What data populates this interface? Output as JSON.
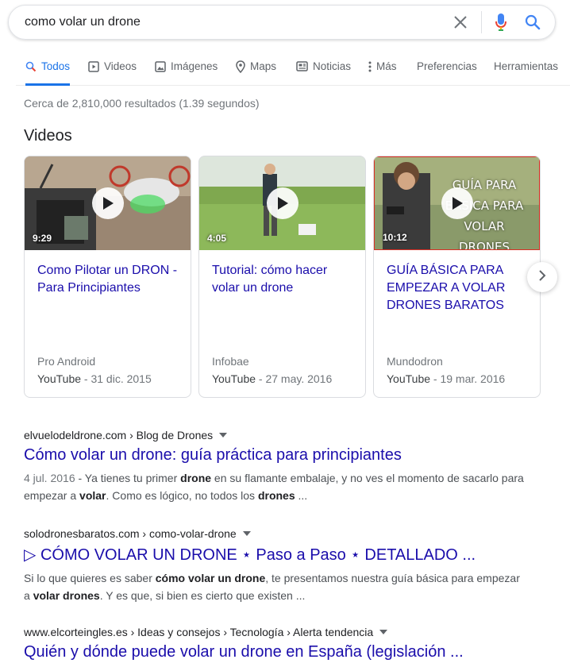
{
  "search": {
    "query": "como volar un drone"
  },
  "tabs": [
    {
      "label": "Todos"
    },
    {
      "label": "Videos"
    },
    {
      "label": "Imágenes"
    },
    {
      "label": "Maps"
    },
    {
      "label": "Noticias"
    },
    {
      "label": "Más"
    },
    {
      "label": "Preferencias"
    },
    {
      "label": "Herramientas"
    }
  ],
  "stats": "Cerca de 2,810,000 resultados (1.39 segundos)",
  "videos_heading": "Videos",
  "videos": [
    {
      "duration": "9:29",
      "title": "Como Pilotar un DRON - Para Principiantes",
      "source": "Pro Android",
      "platform": "YouTube",
      "date": " - 31 dic. 2015"
    },
    {
      "duration": "4:05",
      "title": "Tutorial: cómo hacer volar un drone",
      "source": "Infobae",
      "platform": "YouTube",
      "date": " - 27 may. 2016"
    },
    {
      "duration": "10:12",
      "title": "GUÍA BÁSICA PARA EMPEZAR A VOLAR DRONES BARATOS",
      "source": "Mundodron",
      "platform": "YouTube",
      "date": " - 19 mar. 2016",
      "thumb_text": [
        "GUÍA PARA",
        "BÁSICA PARA VOLAR",
        "DRONES"
      ]
    }
  ],
  "results": [
    {
      "cite": "elvuelodeldrone.com › Blog de Drones",
      "title": "Cómo volar un drone: guía práctica para principiantes",
      "snippet_date": "4 jul. 2016",
      "snippet_parts": [
        " - Ya tienes tu primer ",
        "drone",
        " en su flamante embalaje, y no ves el momento de sacarlo para empezar a ",
        "volar",
        ". Como es lógico, no todos los ",
        "drones",
        " ..."
      ]
    },
    {
      "cite": "solodronesbaratos.com › como-volar-drone",
      "title": "▷ CÓMO VOLAR UN DRONE ⋆ Paso a Paso ⋆ DETALLADO ...",
      "snippet_parts": [
        "Si lo que quieres es saber ",
        "cómo volar un drone",
        ", te presentamos nuestra guía básica para empezar a ",
        "volar drones",
        ". Y es que, si bien es cierto que existen ..."
      ]
    },
    {
      "cite": "www.elcorteingles.es › Ideas y consejos › Tecnología › Alerta tendencia",
      "title": "Quién y dónde puede volar un drone en España (legislación ..."
    }
  ],
  "colors": {
    "link": "#1a0dab",
    "accent": "#1a73e8",
    "mic_red": "#ea4335",
    "mic_yellow": "#fbbc05",
    "mic_green": "#34a853"
  },
  "icons": [
    "close-icon",
    "mic-icon",
    "search-icon",
    "chevron-right-icon",
    "play-icon",
    "caret-down-icon"
  ]
}
